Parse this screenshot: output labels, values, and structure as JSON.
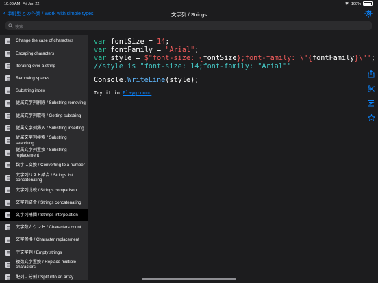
{
  "status": {
    "time": "10:08 AM",
    "date": "Fri Jan 22",
    "battery": "100%"
  },
  "nav": {
    "back_label": "単純型との作業 / Work with simple types",
    "title": "文字列 / Strings"
  },
  "search": {
    "placeholder": "検索"
  },
  "sidebar": {
    "items": [
      {
        "label": "Change the case of characters"
      },
      {
        "label": "Escaping characters"
      },
      {
        "label": "Iterating over a string"
      },
      {
        "label": "Removing spaces"
      },
      {
        "label": "Substring index"
      },
      {
        "label": "従属文字列削除 / Substring removing"
      },
      {
        "label": "従属文字列取得 / Getting substring"
      },
      {
        "label": "従属文字列挿入 / Substring inserting"
      },
      {
        "label": "従属文字列検索 / Substring searching"
      },
      {
        "label": "従属文字列置換 / Substring replacement"
      },
      {
        "label": "数字に変換 / Converting to a number"
      },
      {
        "label": "文字列リスト結合 / Strings list concatenating"
      },
      {
        "label": "文字列比較 / Strings comparison"
      },
      {
        "label": "文字列結合 / Strings concatenating"
      },
      {
        "label": "文字列補間 / Strings interpolation",
        "active": true
      },
      {
        "label": "文字数カウント / Characters count"
      },
      {
        "label": "文字置換 / Character replacement"
      },
      {
        "label": "空文字列 / Empty strings"
      },
      {
        "label": "複数文字置換 / Replace multiple characters"
      },
      {
        "label": "配列に分割 / Split into an array"
      }
    ]
  },
  "code": {
    "l1": [
      "var",
      " fontSize = ",
      "14",
      ";"
    ],
    "l2": [
      "var",
      " fontFamily = ",
      "\"Arial\"",
      ";"
    ],
    "l3": [
      "var",
      " style = ",
      "$\"font-size: {",
      "fontSize",
      "};font-family: \\\"{",
      "fontFamily",
      "}\\\"\"",
      ";"
    ],
    "l4": "//style is \"font-size: 14;font-family: \"Arial\"\"",
    "call": [
      "Console.",
      "WriteLine",
      "(style);"
    ]
  },
  "tryit": {
    "prefix": "Try it in ",
    "link": "Playground"
  },
  "toolbar_icons": [
    "share-icon",
    "scissors-icon",
    "format-icon",
    "star-icon"
  ],
  "colors": {
    "accent": "#0a84ff",
    "keyword": "#2bbd9a",
    "string": "#f25c5c",
    "comment": "#44c3c1"
  }
}
